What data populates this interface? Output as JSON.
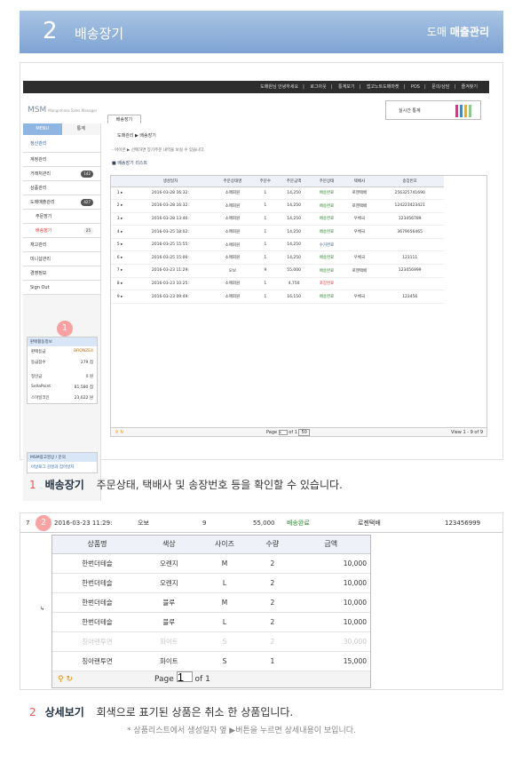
{
  "header": {
    "number": "2",
    "title": "배송장기",
    "right_prefix": "도매",
    "right_title": "매출관리"
  },
  "topbar": {
    "items": [
      "도매원님 안녕하세요",
      "로그아웃",
      "통계보기",
      "앱고노트도매마켓",
      "POS",
      "문의/상담",
      "즐겨찾기"
    ]
  },
  "logo": {
    "text": "MSM",
    "sub": "Mangomasa Sales Manager"
  },
  "page_tab": "배송장기",
  "realtime_btn": "실시간 통계",
  "sidebar": {
    "menu_tab": "MENU",
    "stats_tab": "통계",
    "shortcut": "정산관리",
    "items": [
      {
        "label": "계정관리"
      },
      {
        "label": "거래처관리",
        "count": "142"
      },
      {
        "label": "상품관리"
      },
      {
        "label": "도매매출관리",
        "count": "427"
      },
      {
        "label": "주문장기"
      },
      {
        "label": "배송장기",
        "count": "25"
      },
      {
        "label": "재고관리"
      },
      {
        "label": "미니샵관리"
      },
      {
        "label": "경영정보"
      },
      {
        "label": "Sign Out"
      }
    ],
    "info": {
      "title": "판매활동정보",
      "rows": [
        [
          "판매등급",
          "BRONZE4"
        ],
        [
          "등급점수",
          "279 점"
        ],
        [
          "정산금",
          "0 원"
        ],
        [
          "SellaPoint",
          "81,580 점"
        ],
        [
          "스마일코인",
          "23,622 원"
        ]
      ]
    },
    "ad": {
      "title": "MSM광고영상 / 문의",
      "line": "아날로그 감성과 집어넣지"
    }
  },
  "main": {
    "breadcrumb": "도매관리 ▶ 배송장기",
    "note": "- 아이콘 ▶ 선택하면 장기주문 내역을 보실 수 있습니다.",
    "list_title": "배송장기 리스트",
    "columns": [
      "생성일자",
      "주문상태명",
      "주문수",
      "주문금액",
      "주문상태",
      "택배사",
      "송장번호"
    ],
    "rows": [
      [
        "1",
        "2016-03-28 16:32:",
        "소매회원",
        "1",
        "14,250",
        "배송완료",
        "로젠택배",
        "256325741690"
      ],
      [
        "2",
        "2016-03-28 16:32:",
        "소매회원",
        "1",
        "14,250",
        "배송완료",
        "로젠택배",
        "124223423421"
      ],
      [
        "3",
        "2016-03-28 13:46:",
        "소매회원",
        "1",
        "14,250",
        "배송완료",
        "우체국",
        "123456789"
      ],
      [
        "4",
        "2016-03-25 18:02:",
        "소매회원",
        "1",
        "14,250",
        "배송완료",
        "우체국",
        "3679056465"
      ],
      [
        "5",
        "2016-03-25 15:55:",
        "소매회원",
        "1",
        "14,250",
        "수거완료",
        "",
        ""
      ],
      [
        "6",
        "2016-03-25 15:00:",
        "소매회원",
        "1",
        "14,250",
        "배송완료",
        "우체국",
        "123111"
      ],
      [
        "7",
        "2016-03-23 11:29:",
        "오보",
        "9",
        "55,000",
        "배송완료",
        "로젠택배",
        "123456999"
      ],
      [
        "8",
        "2016-03-23 10:25:",
        "소매회원",
        "1",
        "4,750",
        "포장완료",
        "",
        ""
      ],
      [
        "9",
        "2016-03-23 09:49:",
        "소매회원",
        "1",
        "16,150",
        "배송완료",
        "우체국",
        "123456"
      ]
    ],
    "pager": {
      "page": "Page",
      "value": "1",
      "of": "of 1",
      "per": "50",
      "view": "View 1 - 9 of 9"
    }
  },
  "caption1": {
    "num": "1",
    "title": "배송장기",
    "text": "주문상태, 택배사 및 송장번호 등을 확인할 수 있습니다."
  },
  "detail": {
    "row": {
      "no": "7",
      "date": "2016-03-23 11:29:",
      "buyer": "오보",
      "qty": "9",
      "amount": "55,000",
      "status": "배송완료",
      "courier": "로젠택배",
      "invoice": "123456999"
    },
    "columns": [
      "상품명",
      "색상",
      "사이즈",
      "수량",
      "금액"
    ],
    "rows": [
      [
        "한번더테슬",
        "오렌지",
        "M",
        "2",
        "10,000"
      ],
      [
        "한번더테슬",
        "오렌지",
        "L",
        "2",
        "10,000"
      ],
      [
        "한번더테슬",
        "블루",
        "M",
        "2",
        "10,000"
      ],
      [
        "한번더테슬",
        "블루",
        "L",
        "2",
        "10,000"
      ],
      [
        "칭아랜투면",
        "화이트",
        "S",
        "2",
        "30,000"
      ],
      [
        "칭아랜투면",
        "화이트",
        "S",
        "1",
        "15,000"
      ]
    ],
    "pager": {
      "page": "Page",
      "value": "1",
      "of": "of 1"
    }
  },
  "caption2": {
    "num": "2",
    "title": "상세보기",
    "text": "회색으로 표기된 상품은 취소 한 상품입니다.",
    "foot": "* 상품리스트에서 생성일자 옆 ▶버튼을 누르면 상세내용이 보입니다."
  },
  "markers": {
    "one": "1",
    "two": "2"
  }
}
